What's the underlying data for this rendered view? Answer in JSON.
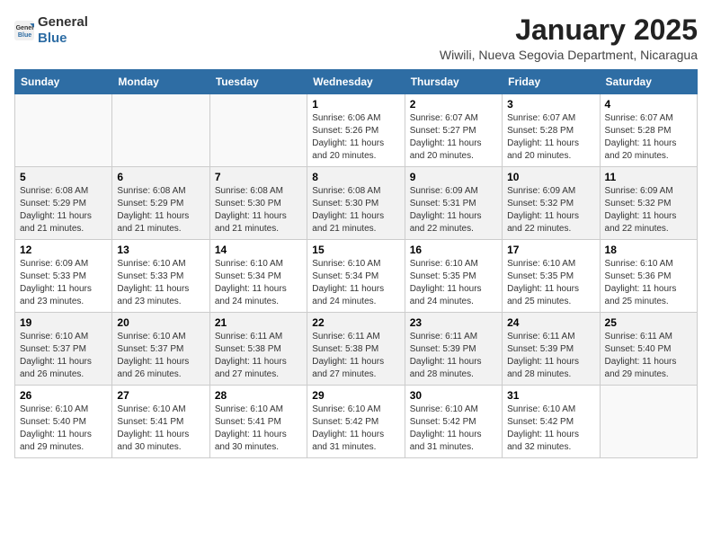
{
  "logo": {
    "text_general": "General",
    "text_blue": "Blue"
  },
  "header": {
    "month_year": "January 2025",
    "location": "Wiwili, Nueva Segovia Department, Nicaragua"
  },
  "weekdays": [
    "Sunday",
    "Monday",
    "Tuesday",
    "Wednesday",
    "Thursday",
    "Friday",
    "Saturday"
  ],
  "weeks": [
    [
      {
        "day": "",
        "info": ""
      },
      {
        "day": "",
        "info": ""
      },
      {
        "day": "",
        "info": ""
      },
      {
        "day": "1",
        "sunrise": "Sunrise: 6:06 AM",
        "sunset": "Sunset: 5:26 PM",
        "daylight": "Daylight: 11 hours and 20 minutes."
      },
      {
        "day": "2",
        "sunrise": "Sunrise: 6:07 AM",
        "sunset": "Sunset: 5:27 PM",
        "daylight": "Daylight: 11 hours and 20 minutes."
      },
      {
        "day": "3",
        "sunrise": "Sunrise: 6:07 AM",
        "sunset": "Sunset: 5:28 PM",
        "daylight": "Daylight: 11 hours and 20 minutes."
      },
      {
        "day": "4",
        "sunrise": "Sunrise: 6:07 AM",
        "sunset": "Sunset: 5:28 PM",
        "daylight": "Daylight: 11 hours and 20 minutes."
      }
    ],
    [
      {
        "day": "5",
        "sunrise": "Sunrise: 6:08 AM",
        "sunset": "Sunset: 5:29 PM",
        "daylight": "Daylight: 11 hours and 21 minutes."
      },
      {
        "day": "6",
        "sunrise": "Sunrise: 6:08 AM",
        "sunset": "Sunset: 5:29 PM",
        "daylight": "Daylight: 11 hours and 21 minutes."
      },
      {
        "day": "7",
        "sunrise": "Sunrise: 6:08 AM",
        "sunset": "Sunset: 5:30 PM",
        "daylight": "Daylight: 11 hours and 21 minutes."
      },
      {
        "day": "8",
        "sunrise": "Sunrise: 6:08 AM",
        "sunset": "Sunset: 5:30 PM",
        "daylight": "Daylight: 11 hours and 21 minutes."
      },
      {
        "day": "9",
        "sunrise": "Sunrise: 6:09 AM",
        "sunset": "Sunset: 5:31 PM",
        "daylight": "Daylight: 11 hours and 22 minutes."
      },
      {
        "day": "10",
        "sunrise": "Sunrise: 6:09 AM",
        "sunset": "Sunset: 5:32 PM",
        "daylight": "Daylight: 11 hours and 22 minutes."
      },
      {
        "day": "11",
        "sunrise": "Sunrise: 6:09 AM",
        "sunset": "Sunset: 5:32 PM",
        "daylight": "Daylight: 11 hours and 22 minutes."
      }
    ],
    [
      {
        "day": "12",
        "sunrise": "Sunrise: 6:09 AM",
        "sunset": "Sunset: 5:33 PM",
        "daylight": "Daylight: 11 hours and 23 minutes."
      },
      {
        "day": "13",
        "sunrise": "Sunrise: 6:10 AM",
        "sunset": "Sunset: 5:33 PM",
        "daylight": "Daylight: 11 hours and 23 minutes."
      },
      {
        "day": "14",
        "sunrise": "Sunrise: 6:10 AM",
        "sunset": "Sunset: 5:34 PM",
        "daylight": "Daylight: 11 hours and 24 minutes."
      },
      {
        "day": "15",
        "sunrise": "Sunrise: 6:10 AM",
        "sunset": "Sunset: 5:34 PM",
        "daylight": "Daylight: 11 hours and 24 minutes."
      },
      {
        "day": "16",
        "sunrise": "Sunrise: 6:10 AM",
        "sunset": "Sunset: 5:35 PM",
        "daylight": "Daylight: 11 hours and 24 minutes."
      },
      {
        "day": "17",
        "sunrise": "Sunrise: 6:10 AM",
        "sunset": "Sunset: 5:35 PM",
        "daylight": "Daylight: 11 hours and 25 minutes."
      },
      {
        "day": "18",
        "sunrise": "Sunrise: 6:10 AM",
        "sunset": "Sunset: 5:36 PM",
        "daylight": "Daylight: 11 hours and 25 minutes."
      }
    ],
    [
      {
        "day": "19",
        "sunrise": "Sunrise: 6:10 AM",
        "sunset": "Sunset: 5:37 PM",
        "daylight": "Daylight: 11 hours and 26 minutes."
      },
      {
        "day": "20",
        "sunrise": "Sunrise: 6:10 AM",
        "sunset": "Sunset: 5:37 PM",
        "daylight": "Daylight: 11 hours and 26 minutes."
      },
      {
        "day": "21",
        "sunrise": "Sunrise: 6:11 AM",
        "sunset": "Sunset: 5:38 PM",
        "daylight": "Daylight: 11 hours and 27 minutes."
      },
      {
        "day": "22",
        "sunrise": "Sunrise: 6:11 AM",
        "sunset": "Sunset: 5:38 PM",
        "daylight": "Daylight: 11 hours and 27 minutes."
      },
      {
        "day": "23",
        "sunrise": "Sunrise: 6:11 AM",
        "sunset": "Sunset: 5:39 PM",
        "daylight": "Daylight: 11 hours and 28 minutes."
      },
      {
        "day": "24",
        "sunrise": "Sunrise: 6:11 AM",
        "sunset": "Sunset: 5:39 PM",
        "daylight": "Daylight: 11 hours and 28 minutes."
      },
      {
        "day": "25",
        "sunrise": "Sunrise: 6:11 AM",
        "sunset": "Sunset: 5:40 PM",
        "daylight": "Daylight: 11 hours and 29 minutes."
      }
    ],
    [
      {
        "day": "26",
        "sunrise": "Sunrise: 6:10 AM",
        "sunset": "Sunset: 5:40 PM",
        "daylight": "Daylight: 11 hours and 29 minutes."
      },
      {
        "day": "27",
        "sunrise": "Sunrise: 6:10 AM",
        "sunset": "Sunset: 5:41 PM",
        "daylight": "Daylight: 11 hours and 30 minutes."
      },
      {
        "day": "28",
        "sunrise": "Sunrise: 6:10 AM",
        "sunset": "Sunset: 5:41 PM",
        "daylight": "Daylight: 11 hours and 30 minutes."
      },
      {
        "day": "29",
        "sunrise": "Sunrise: 6:10 AM",
        "sunset": "Sunset: 5:42 PM",
        "daylight": "Daylight: 11 hours and 31 minutes."
      },
      {
        "day": "30",
        "sunrise": "Sunrise: 6:10 AM",
        "sunset": "Sunset: 5:42 PM",
        "daylight": "Daylight: 11 hours and 31 minutes."
      },
      {
        "day": "31",
        "sunrise": "Sunrise: 6:10 AM",
        "sunset": "Sunset: 5:42 PM",
        "daylight": "Daylight: 11 hours and 32 minutes."
      },
      {
        "day": "",
        "info": ""
      }
    ]
  ]
}
